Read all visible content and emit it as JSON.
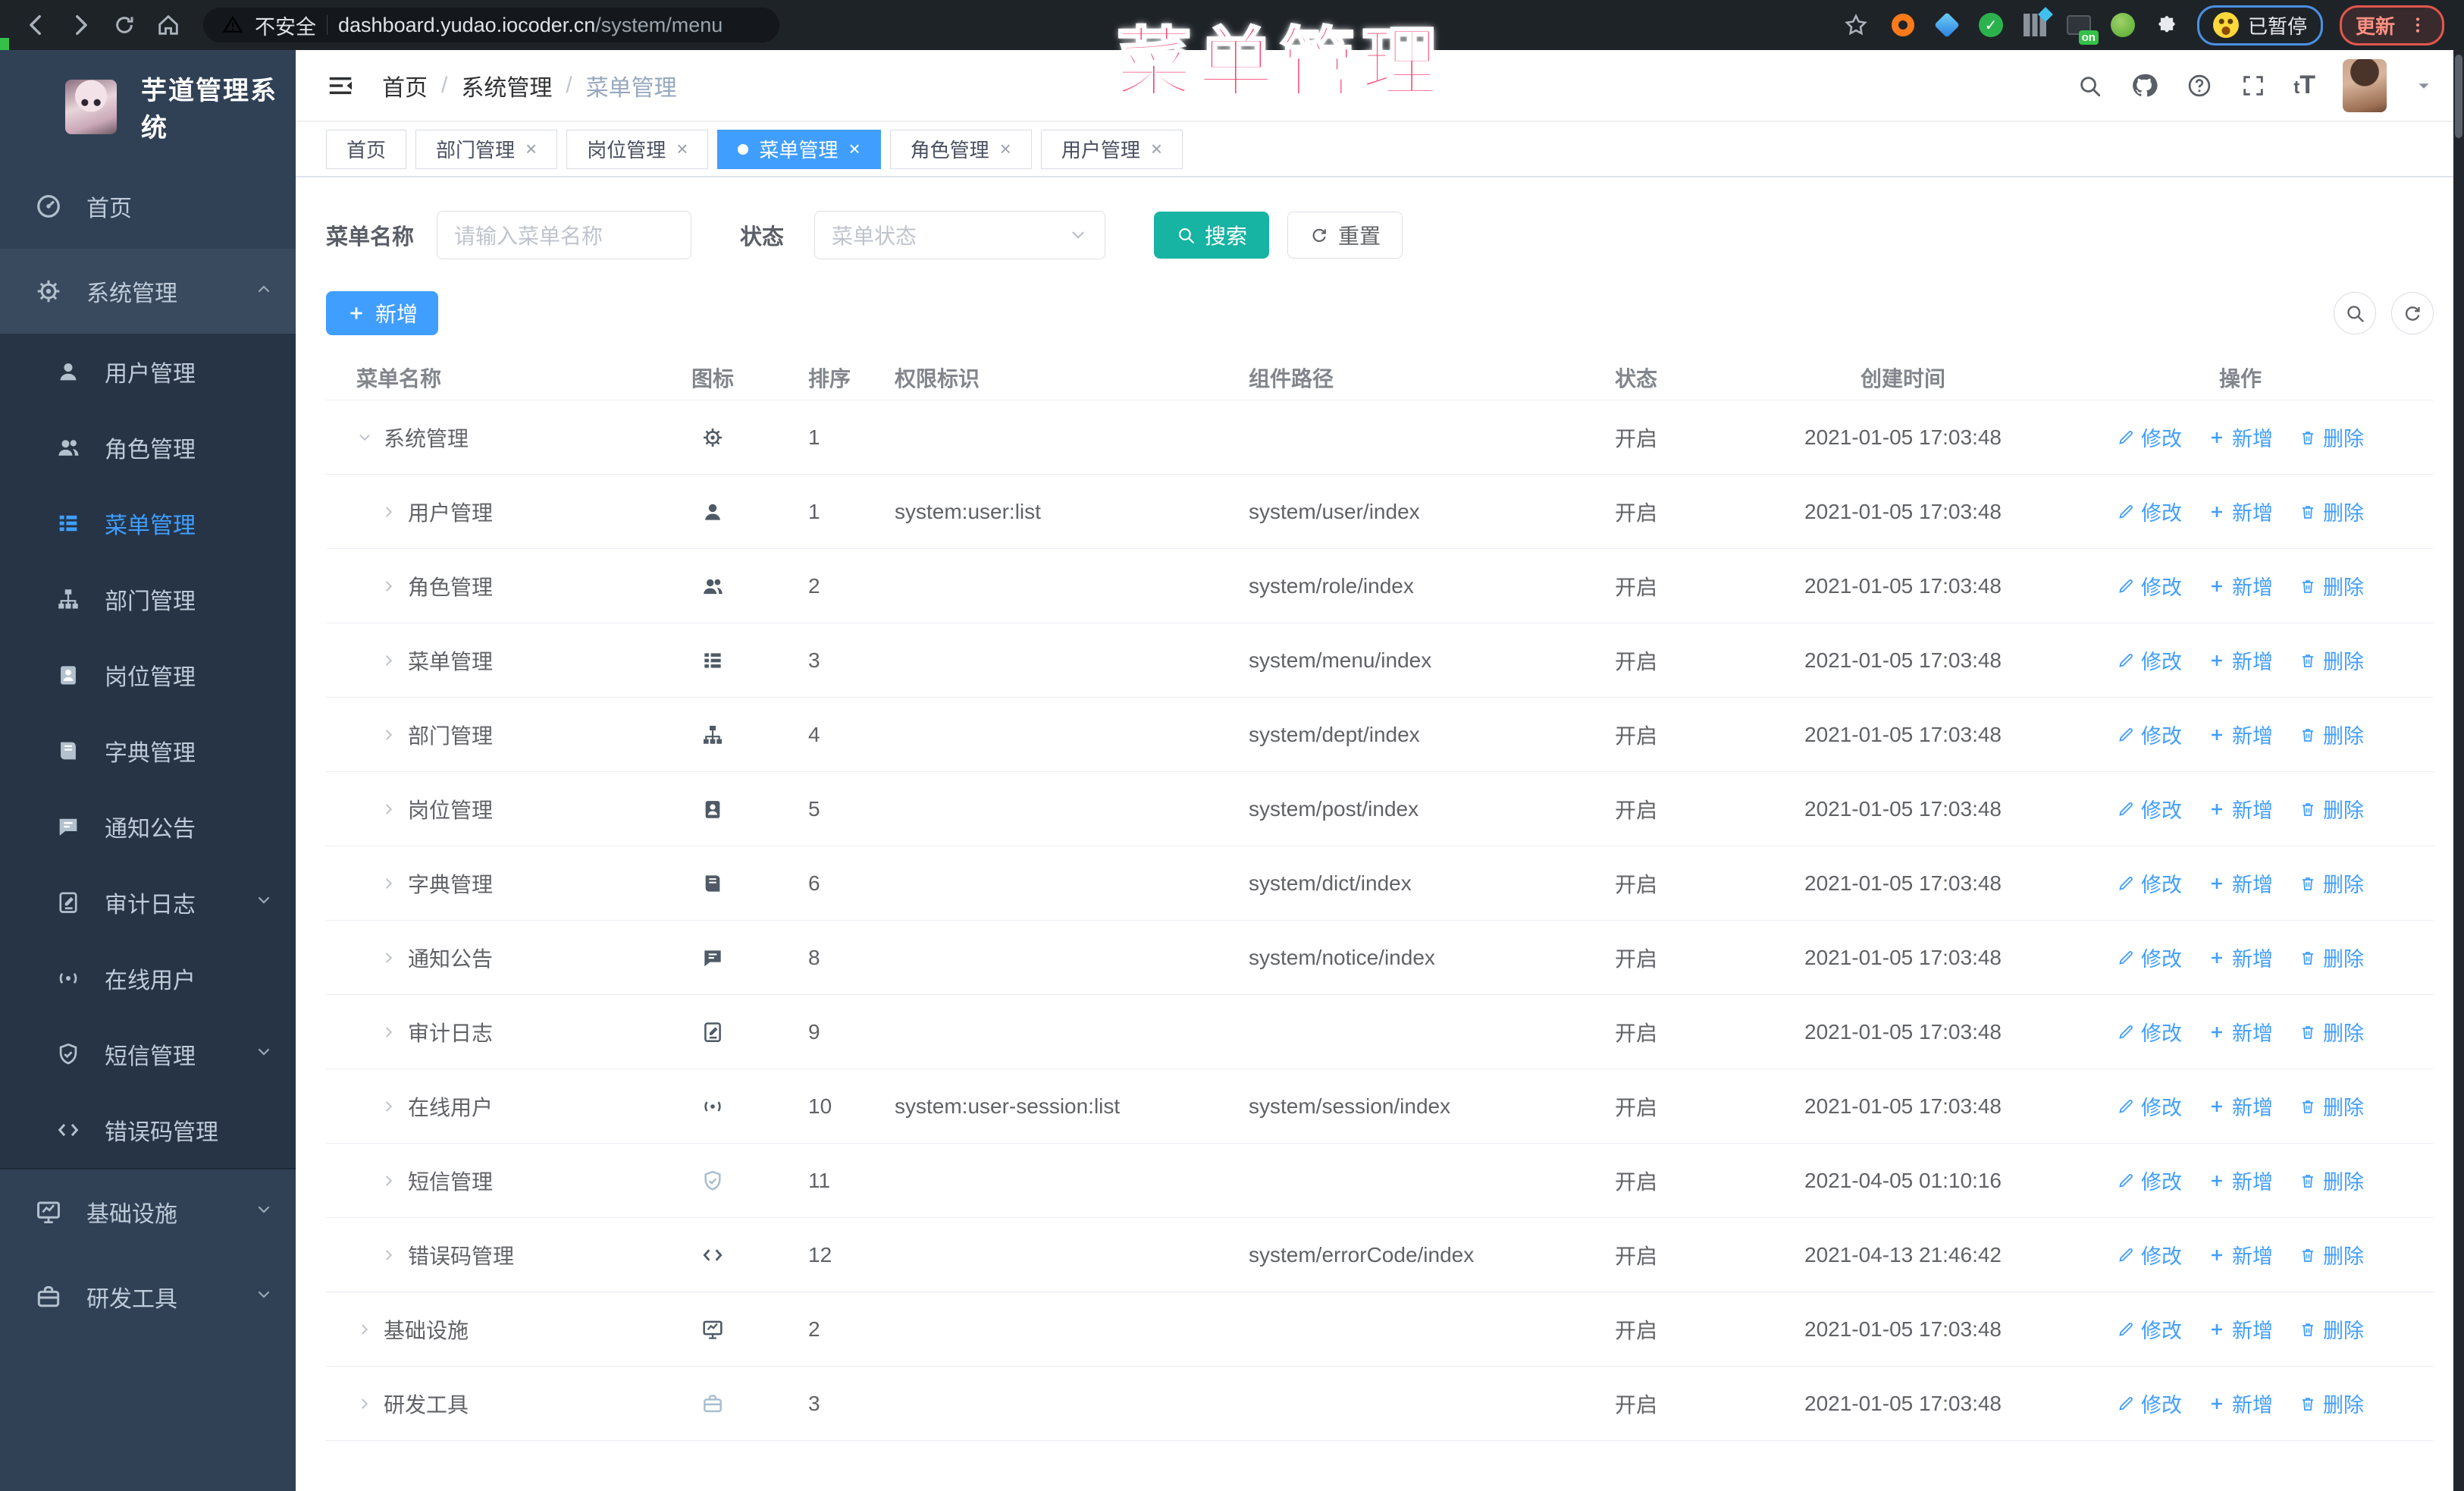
{
  "overlay_title": "菜单管理",
  "browser": {
    "security_label": "不安全",
    "url_host": "dashboard.yudao.iocoder.cn",
    "url_path": "/system/menu",
    "paused_label": "已暂停",
    "update_label": "更新",
    "on_badge": "on"
  },
  "app": {
    "title": "芋道管理系统"
  },
  "breadcrumb": {
    "items": [
      "首页",
      "系统管理",
      "菜单管理"
    ]
  },
  "header_icons": [
    "search-icon",
    "github-icon",
    "help-icon",
    "fullscreen-icon",
    "font-size-icon",
    "avatar",
    "caret-down-icon"
  ],
  "tabs": [
    {
      "label": "首页",
      "closable": false,
      "active": false
    },
    {
      "label": "部门管理",
      "closable": true,
      "active": false
    },
    {
      "label": "岗位管理",
      "closable": true,
      "active": false
    },
    {
      "label": "菜单管理",
      "closable": true,
      "active": true
    },
    {
      "label": "角色管理",
      "closable": true,
      "active": false
    },
    {
      "label": "用户管理",
      "closable": true,
      "active": false
    }
  ],
  "sidebar": {
    "items": [
      {
        "label": "首页",
        "icon": "dashboard",
        "level": 1
      },
      {
        "label": "系统管理",
        "icon": "gear",
        "level": 1,
        "arrow": "up",
        "open": true
      },
      {
        "label": "用户管理",
        "icon": "user",
        "level": 2
      },
      {
        "label": "角色管理",
        "icon": "users",
        "level": 2
      },
      {
        "label": "菜单管理",
        "icon": "menu",
        "level": 2,
        "active": true
      },
      {
        "label": "部门管理",
        "icon": "tree",
        "level": 2
      },
      {
        "label": "岗位管理",
        "icon": "badge",
        "level": 2
      },
      {
        "label": "字典管理",
        "icon": "book",
        "level": 2
      },
      {
        "label": "通知公告",
        "icon": "chat",
        "level": 2
      },
      {
        "label": "审计日志",
        "icon": "log",
        "level": 2,
        "arrow": "down"
      },
      {
        "label": "在线用户",
        "icon": "online",
        "level": 2
      },
      {
        "label": "短信管理",
        "icon": "shield",
        "level": 2,
        "arrow": "down"
      },
      {
        "label": "错误码管理",
        "icon": "code",
        "level": 2
      },
      {
        "label": "基础设施",
        "icon": "monitor",
        "level": 1,
        "arrow": "down",
        "divider_before": true
      },
      {
        "label": "研发工具",
        "icon": "tool",
        "level": 1,
        "arrow": "down"
      }
    ]
  },
  "filters": {
    "name_label": "菜单名称",
    "name_placeholder": "请输入菜单名称",
    "status_label": "状态",
    "status_placeholder": "菜单状态",
    "search_label": "搜索",
    "reset_label": "重置"
  },
  "toolbar": {
    "add_label": "新增"
  },
  "table": {
    "headers": [
      "菜单名称",
      "图标",
      "排序",
      "权限标识",
      "组件路径",
      "状态",
      "创建时间",
      "操作"
    ],
    "action_labels": {
      "edit": "修改",
      "add": "新增",
      "delete": "删除"
    },
    "rows": [
      {
        "name": "系统管理",
        "level": 1,
        "caret": "down",
        "icon": "gear",
        "sort": "1",
        "perm": "",
        "path": "",
        "status": "开启",
        "time": "2021-01-05 17:03:48"
      },
      {
        "name": "用户管理",
        "level": 2,
        "caret": "right",
        "icon": "user",
        "sort": "1",
        "perm": "system:user:list",
        "path": "system/user/index",
        "status": "开启",
        "time": "2021-01-05 17:03:48"
      },
      {
        "name": "角色管理",
        "level": 2,
        "caret": "right",
        "icon": "users",
        "sort": "2",
        "perm": "",
        "path": "system/role/index",
        "status": "开启",
        "time": "2021-01-05 17:03:48"
      },
      {
        "name": "菜单管理",
        "level": 2,
        "caret": "right",
        "icon": "menu",
        "sort": "3",
        "perm": "",
        "path": "system/menu/index",
        "status": "开启",
        "time": "2021-01-05 17:03:48"
      },
      {
        "name": "部门管理",
        "level": 2,
        "caret": "right",
        "icon": "tree",
        "sort": "4",
        "perm": "",
        "path": "system/dept/index",
        "status": "开启",
        "time": "2021-01-05 17:03:48"
      },
      {
        "name": "岗位管理",
        "level": 2,
        "caret": "right",
        "icon": "badge",
        "sort": "5",
        "perm": "",
        "path": "system/post/index",
        "status": "开启",
        "time": "2021-01-05 17:03:48"
      },
      {
        "name": "字典管理",
        "level": 2,
        "caret": "right",
        "icon": "book",
        "sort": "6",
        "perm": "",
        "path": "system/dict/index",
        "status": "开启",
        "time": "2021-01-05 17:03:48"
      },
      {
        "name": "通知公告",
        "level": 2,
        "caret": "right",
        "icon": "chat",
        "sort": "8",
        "perm": "",
        "path": "system/notice/index",
        "status": "开启",
        "time": "2021-01-05 17:03:48"
      },
      {
        "name": "审计日志",
        "level": 2,
        "caret": "right",
        "icon": "log",
        "sort": "9",
        "perm": "",
        "path": "",
        "status": "开启",
        "time": "2021-01-05 17:03:48"
      },
      {
        "name": "在线用户",
        "level": 2,
        "caret": "right",
        "icon": "online",
        "sort": "10",
        "perm": "system:user-session:list",
        "path": "system/session/index",
        "status": "开启",
        "time": "2021-01-05 17:03:48"
      },
      {
        "name": "短信管理",
        "level": 2,
        "caret": "right",
        "icon": "shield",
        "icon_light": true,
        "sort": "11",
        "perm": "",
        "path": "",
        "status": "开启",
        "time": "2021-04-05 01:10:16"
      },
      {
        "name": "错误码管理",
        "level": 2,
        "caret": "right",
        "icon": "code",
        "sort": "12",
        "perm": "",
        "path": "system/errorCode/index",
        "status": "开启",
        "time": "2021-04-13 21:46:42"
      },
      {
        "name": "基础设施",
        "level": 1,
        "caret": "right",
        "icon": "monitor",
        "sort": "2",
        "perm": "",
        "path": "",
        "status": "开启",
        "time": "2021-01-05 17:03:48"
      },
      {
        "name": "研发工具",
        "level": 1,
        "caret": "right",
        "icon": "tool",
        "icon_light": true,
        "sort": "3",
        "perm": "",
        "path": "",
        "status": "开启",
        "time": "2021-01-05 17:03:48"
      }
    ]
  },
  "colors": {
    "primary": "#409eff",
    "teal": "#17b3a3",
    "overlay_pink": "#fb4070",
    "sidebar_bg": "#304156",
    "submenu_bg": "#263445"
  }
}
